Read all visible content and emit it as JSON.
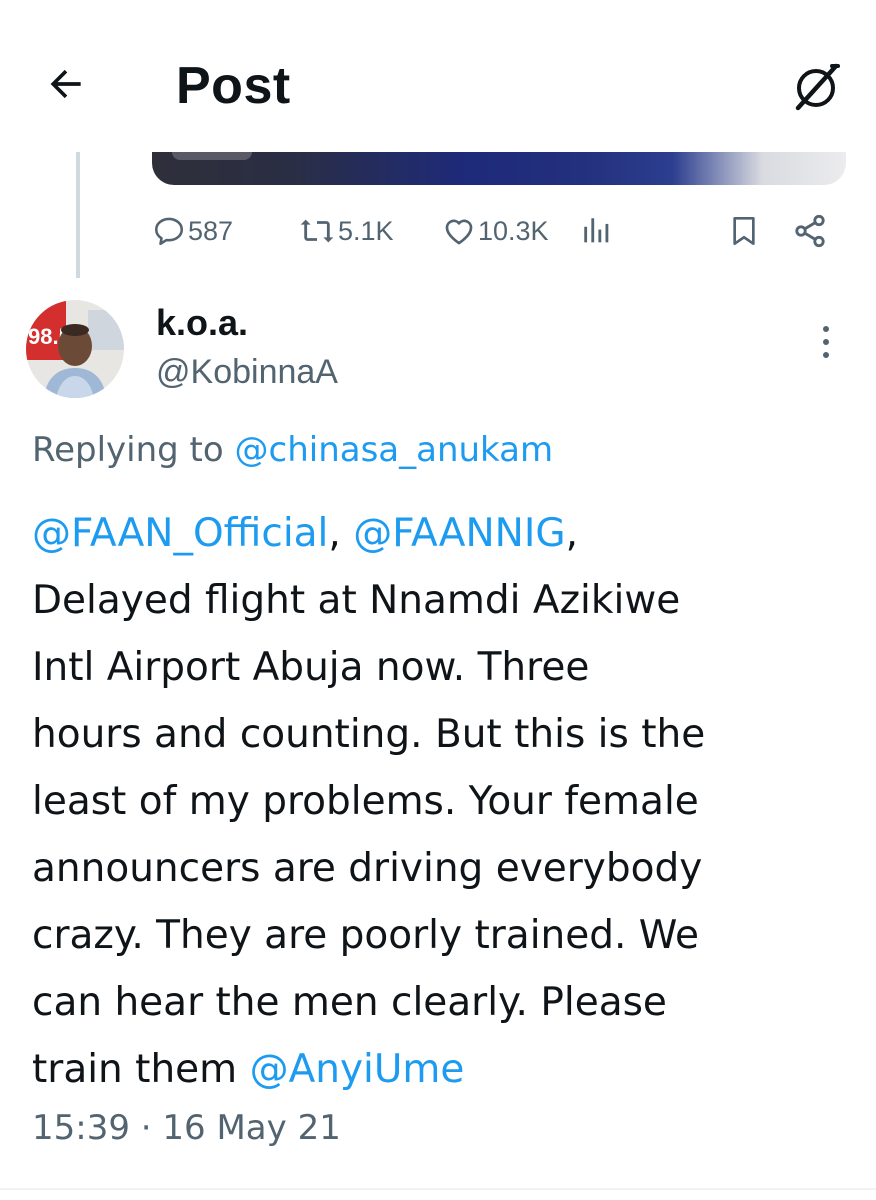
{
  "header": {
    "title": "Post",
    "back_icon": "arrow-left-icon",
    "grok_icon": "grok-slash-icon"
  },
  "previous_post": {
    "actions": {
      "replies": "587",
      "reposts": "5.1K",
      "likes": "10.3K"
    },
    "icons": {
      "reply": "speech-bubble-icon",
      "repost": "repost-arrows-icon",
      "like": "heart-icon",
      "views": "bar-chart-icon",
      "bookmark": "bookmark-icon",
      "share": "share-icon"
    }
  },
  "reply": {
    "display_name": "k.o.a.",
    "handle": "@KobinnaA",
    "replying_prefix": "Replying to",
    "replying_to": "@chinasa_anukam",
    "body": {
      "mention1": "@FAAN_Official",
      "sep1": ", ",
      "mention2": "@FAANNIG",
      "sep2": ",",
      "line2": "Delayed flight at Nnamdi Azikiwe",
      "line3": "Intl Airport Abuja now. Three",
      "line4": "hours and counting. But this is the",
      "line5": "least of my problems. Your female",
      "line6": "announcers are driving everybody",
      "line7": "crazy. They are poorly trained. We",
      "line8": "can hear the men clearly. Please",
      "line9_prefix": "train them ",
      "mention3": "@AnyiUme"
    },
    "timestamp": "15:39 · 16 May 21"
  },
  "colors": {
    "text": "#0f1419",
    "secondary": "#536471",
    "link": "#1d9bf0",
    "divider": "#eff3f4"
  }
}
